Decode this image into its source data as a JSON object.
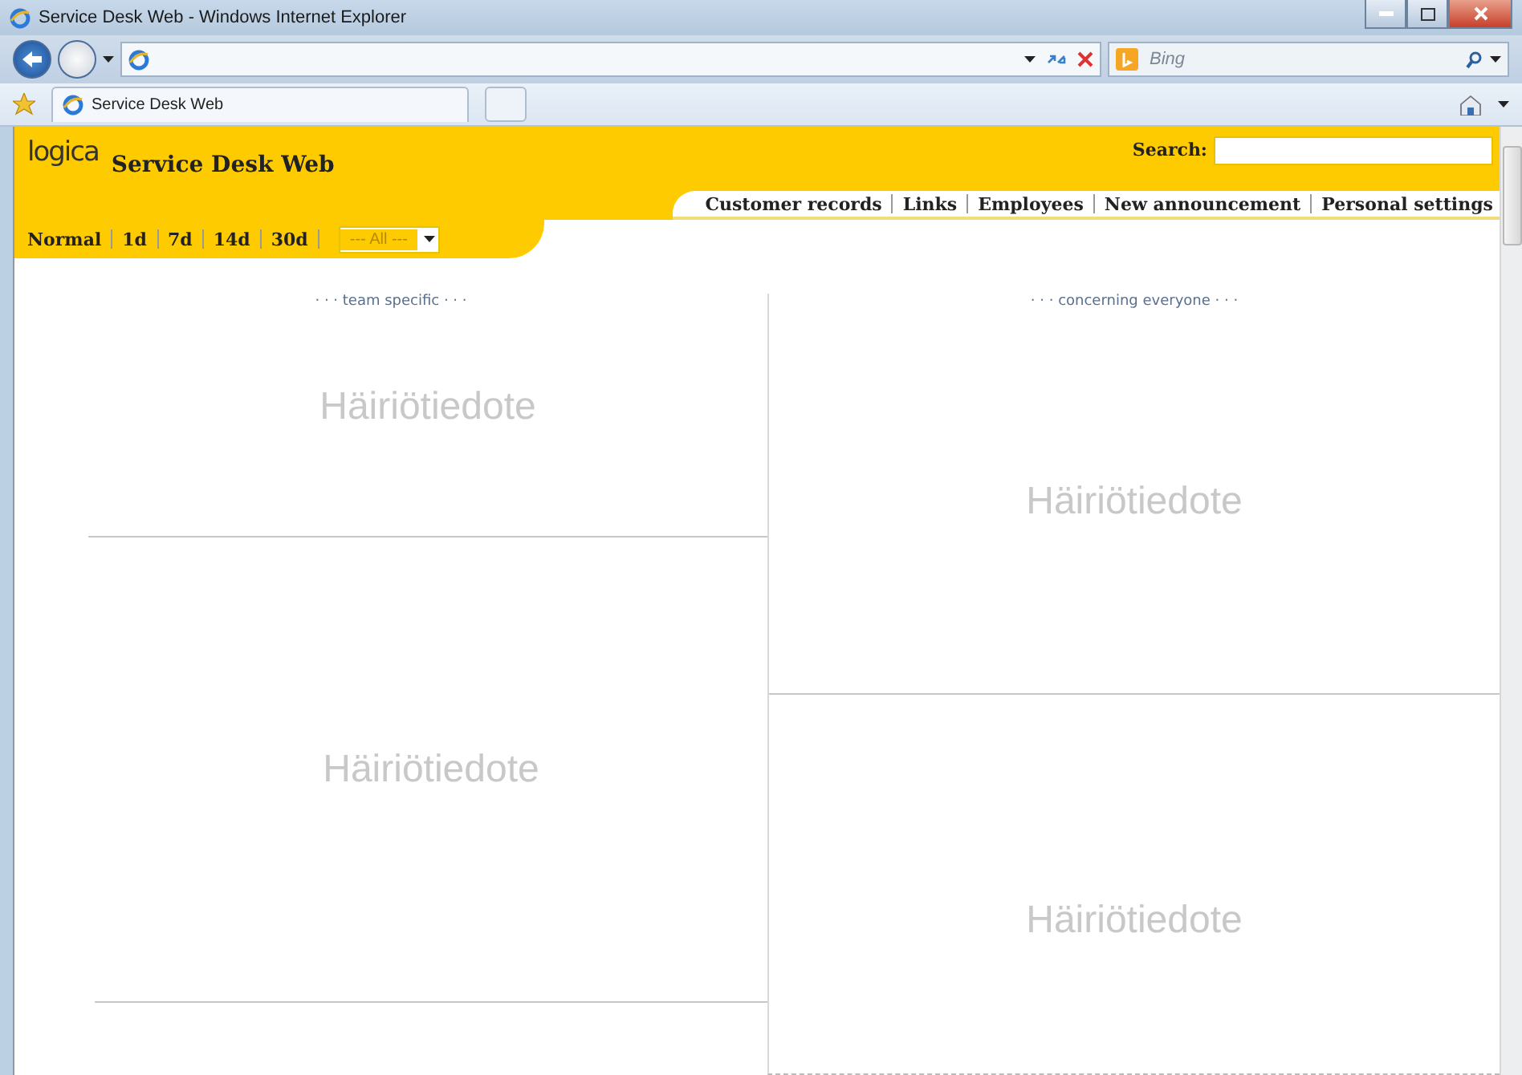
{
  "window": {
    "title": "Service Desk Web - Windows Internet Explorer"
  },
  "browser": {
    "search_placeholder": "Bing",
    "tab": "Service Desk Web"
  },
  "header": {
    "logo": "logica",
    "title": "Service Desk Web",
    "search_label": "Search:"
  },
  "nav_links": [
    "Customer records",
    "Links",
    "Employees",
    "New announcement",
    "Personal settings"
  ],
  "filters": [
    "Normal",
    "1d",
    "7d",
    "14d",
    "30d"
  ],
  "filter_dropdown": "--- All ---",
  "columns": [
    {
      "heading": "· · · team specific · · ·",
      "announcements": [
        "Häiriötiedote",
        "Häiriötiedote"
      ]
    },
    {
      "heading": "· · · concerning everyone · · ·",
      "announcements": [
        "Häiriötiedote",
        "Häiriötiedote"
      ]
    }
  ]
}
